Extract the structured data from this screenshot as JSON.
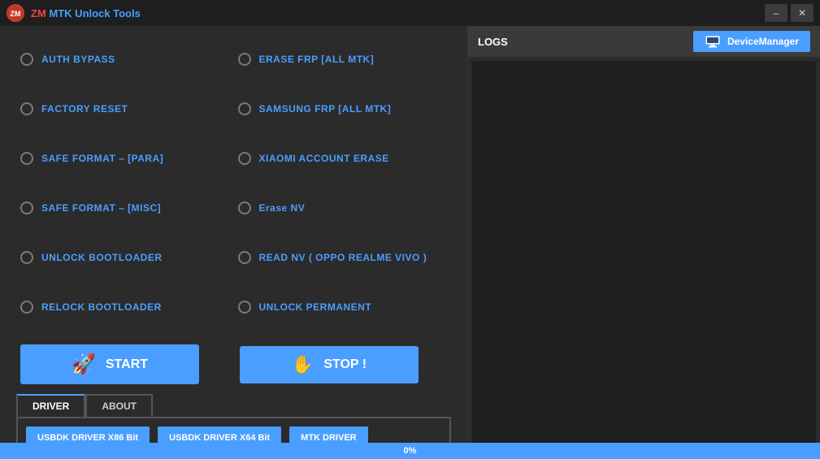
{
  "titleBar": {
    "logoText": "ZM",
    "appTitle": "MTK Unlock Tools",
    "minimizeLabel": "–",
    "closeLabel": "✕"
  },
  "leftPanel": {
    "options": [
      {
        "id": "auth-bypass",
        "label": "AUTH BYPASS",
        "selected": false
      },
      {
        "id": "erase-frp",
        "label": "ERASE FRP [ALL MTK]",
        "selected": false
      },
      {
        "id": "factory-reset",
        "label": "FACTORY RESET",
        "selected": false
      },
      {
        "id": "samsung-frp",
        "label": "SAMSUNG FRP [ALL MTK]",
        "selected": false
      },
      {
        "id": "safe-format-para",
        "label": "SAFE FORMAT – [PARA]",
        "selected": false
      },
      {
        "id": "xiaomi-account",
        "label": "XIAOMI ACCOUNT ERASE",
        "selected": false
      },
      {
        "id": "safe-format-misc",
        "label": "SAFE FORMAT – [MISC]",
        "selected": false
      },
      {
        "id": "erase-nv",
        "label": "Erase NV",
        "selected": false
      },
      {
        "id": "unlock-bootloader",
        "label": "UNLOCK BOOTLOADER",
        "selected": false
      },
      {
        "id": "read-nv",
        "label": "READ NV ( OPPO REALME VIVO )",
        "selected": false
      },
      {
        "id": "relock-bootloader",
        "label": "RELOCK BOOTLOADER",
        "selected": false
      },
      {
        "id": "unlock-permanent",
        "label": "UNLOCK PERMANENT",
        "selected": false
      }
    ],
    "startButton": "START",
    "stopButton": "STOP !",
    "tabs": [
      {
        "id": "driver",
        "label": "DRIVER",
        "active": true
      },
      {
        "id": "about",
        "label": "ABOUT",
        "active": false
      }
    ],
    "driverButtons": [
      {
        "id": "usbdk-x86",
        "label": "USBDK DRIVER X86 Bit"
      },
      {
        "id": "usbdk-x64",
        "label": "USBDK DRIVER X64 Bit"
      },
      {
        "id": "mtk-driver",
        "label": "MTK DRIVER"
      }
    ]
  },
  "rightPanel": {
    "logsTitle": "LOGS",
    "deviceManagerLabel": "DeviceManager"
  },
  "progressBar": {
    "percent": "0%"
  }
}
